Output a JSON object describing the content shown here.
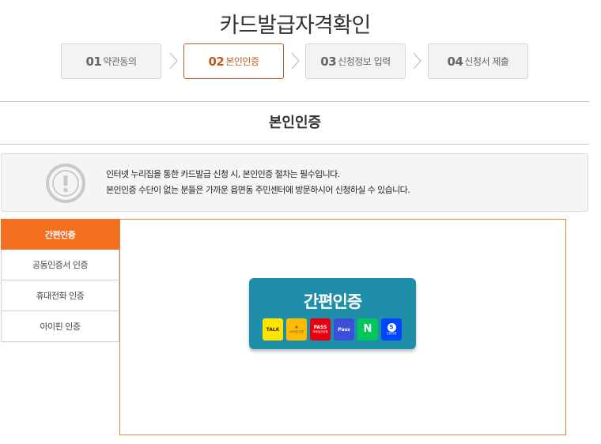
{
  "page": {
    "title": "카드발급자격확인"
  },
  "steps": [
    {
      "num": "01",
      "label": "약관동의",
      "active": false
    },
    {
      "num": "02",
      "label": "본인인증",
      "active": true
    },
    {
      "num": "03",
      "label": "신청정보 입력",
      "active": false
    },
    {
      "num": "04",
      "label": "신청서 제출",
      "active": false
    }
  ],
  "section": {
    "title": "본인인증"
  },
  "notice": {
    "icon": "exclamation-circle-icon",
    "line1": "인터넷 누리집을 통한 카드발급 신청 시, 본인인증 절차는 필수입니다.",
    "line2": "본인인증 수단이 없는 분들은 가까운 읍면동 주민센터에 방문하시어 신청하실 수 있습니다."
  },
  "tabs": [
    {
      "label": "간편인증",
      "active": true
    },
    {
      "label": "공동인증서 인증",
      "active": false
    },
    {
      "label": "휴대전화 인증",
      "active": false
    },
    {
      "label": "아이핀 인증",
      "active": false
    }
  ],
  "simple_auth": {
    "title": "간편인증",
    "apps": [
      {
        "name": "kakao-talk-icon",
        "label": "TALK",
        "sub": "",
        "bg": "#fee500",
        "fg": "#3c1e1e"
      },
      {
        "name": "kb-bank-icon",
        "label": "★",
        "sub": "KB국민은행",
        "bg": "#ffbc00",
        "fg": "#60584c"
      },
      {
        "name": "pass-icon",
        "label": "PASS",
        "sub": "모바일신분증",
        "bg": "#e60012",
        "fg": "#ffffff"
      },
      {
        "name": "pass-blue-icon",
        "label": "Pass",
        "sub": "",
        "bg": "#3b4fd8",
        "fg": "#ffffff"
      },
      {
        "name": "naver-icon",
        "label": "N",
        "sub": "",
        "bg": "#03c75a",
        "fg": "#ffffff"
      },
      {
        "name": "shinhan-icon",
        "label": "S",
        "sub": "신한인증",
        "bg": "#0046ff",
        "fg": "#ffffff"
      }
    ]
  }
}
